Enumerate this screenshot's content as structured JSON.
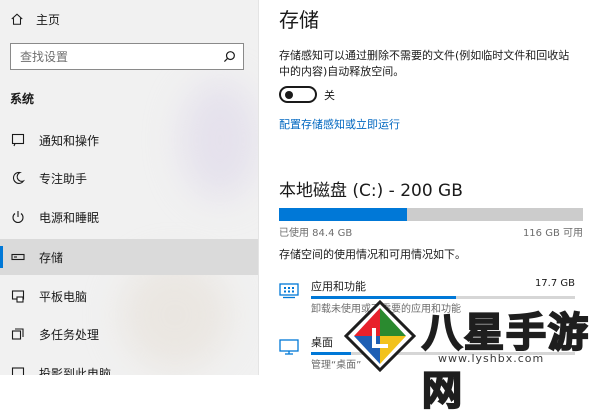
{
  "sidebar": {
    "home_label": "主页",
    "search_placeholder": "查找设置",
    "section_title": "系统",
    "items": [
      {
        "label": "通知和操作",
        "icon": "notification-icon"
      },
      {
        "label": "专注助手",
        "icon": "moon-icon"
      },
      {
        "label": "电源和睡眠",
        "icon": "power-icon"
      },
      {
        "label": "存储",
        "icon": "storage-icon",
        "active": true
      },
      {
        "label": "平板电脑",
        "icon": "tablet-icon"
      },
      {
        "label": "多任务处理",
        "icon": "multitask-icon"
      },
      {
        "label": "投影到此电脑",
        "icon": "project-icon"
      }
    ]
  },
  "main": {
    "title": "存储",
    "description": "存储感知可以通过删除不需要的文件(例如临时文件和回收站中的内容)自动释放空间。",
    "toggle": {
      "state_label": "关",
      "on": false
    },
    "configure_link": "配置存储感知或立即运行",
    "disk": {
      "title": "本地磁盘 (C:) - 200 GB",
      "used_label": "已使用 84.4 GB",
      "available_label": "116 GB 可用",
      "used_fraction": 0.422
    },
    "usage_description": "存储空间的使用情况和可用情况如下。",
    "categories": [
      {
        "name": "应用和功能",
        "size": "17.7 GB",
        "subtitle": "卸载未使用或不需要的应用和功能",
        "fraction": 0.55,
        "icon": "apps-icon"
      },
      {
        "name": "桌面",
        "size": "",
        "subtitle": "管理“桌面”",
        "fraction": 0.15,
        "icon": "desktop-icon"
      }
    ]
  },
  "watermark": {
    "brand": "八星手游网",
    "url": "www.lyshbx.com"
  },
  "colors": {
    "accent": "#0078d7",
    "link": "#0067c0",
    "sidebar_bg": "#f1f1f1",
    "active_bg": "#dadada"
  }
}
